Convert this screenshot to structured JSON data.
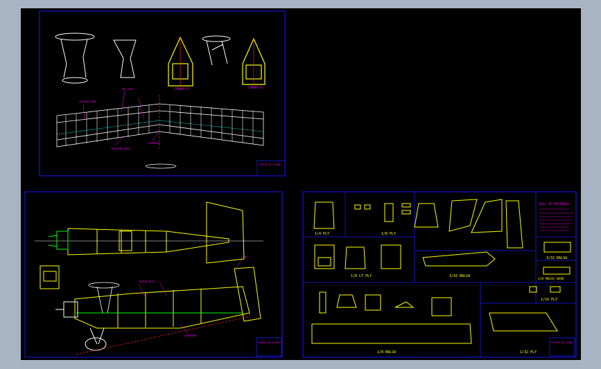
{
  "colors": {
    "background": "#a8b4c4",
    "canvas": "#000000",
    "frame": "#1a1aff",
    "part": "#ffff00",
    "wire": "#ffffff",
    "note": "#ff00ff",
    "green": "#00ff00",
    "red": "#ff2020"
  },
  "sheet1": {
    "title_block": "FIESTA RC PLANS"
  },
  "sheet2": {
    "title_block": "FIESTA RC PLANS"
  },
  "sheet3": {
    "labels": {
      "ply_14": "1/4 PLY",
      "ply_18": "1/8 PLY",
      "lt_ply": "1/8 LT PLY",
      "balsa_316": "3/16 BALSA",
      "balsa_332": "3/32 BALSA",
      "music_wire": "1/8 MUSIC WIRE",
      "ply_116": "1/16 PLY",
      "balsa_18": "1/8 BALSA",
      "ply_132": "1/32 PLY"
    },
    "bill_of_material": {
      "title": "BILL OF MATERIAL"
    },
    "title_block": "FIESTA RC PLANS"
  }
}
